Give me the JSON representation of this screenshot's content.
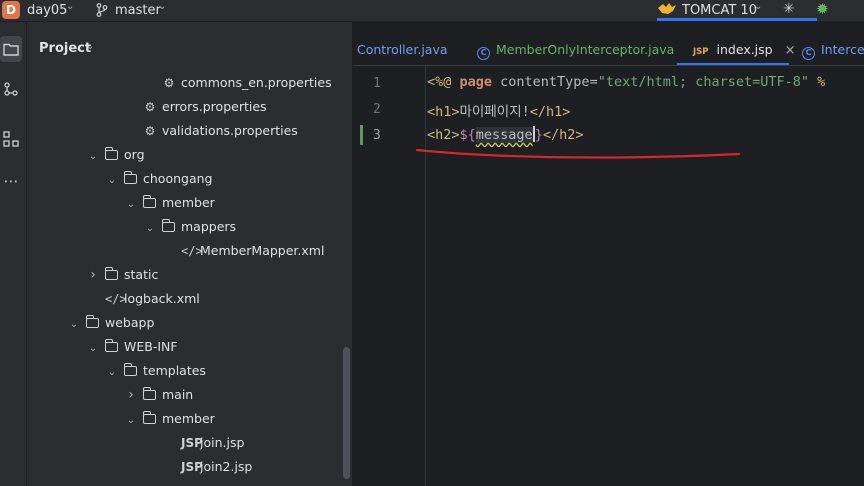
{
  "titlebar": {
    "project_badge": "D",
    "project_name": "day05",
    "branch": "master",
    "run_config": "TOMCAT 10"
  },
  "project_panel": {
    "title": "Project",
    "tree": [
      {
        "label": "commons_en.properties",
        "type": "properties",
        "depth": 7,
        "arrow": ""
      },
      {
        "label": "errors.properties",
        "type": "properties",
        "depth": 6,
        "arrow": ""
      },
      {
        "label": "validations.properties",
        "type": "properties",
        "depth": 6,
        "arrow": ""
      },
      {
        "label": "org",
        "type": "folder",
        "depth": 4,
        "arrow": "down"
      },
      {
        "label": "choongang",
        "type": "folder",
        "depth": 5,
        "arrow": "down"
      },
      {
        "label": "member",
        "type": "folder",
        "depth": 6,
        "arrow": "down"
      },
      {
        "label": "mappers",
        "type": "folder",
        "depth": 7,
        "arrow": "down"
      },
      {
        "label": "MemberMapper.xml",
        "type": "xml",
        "depth": 8,
        "arrow": ""
      },
      {
        "label": "static",
        "type": "folder",
        "depth": 4,
        "arrow": "right"
      },
      {
        "label": "logback.xml",
        "type": "xml",
        "depth": 4,
        "arrow": ""
      },
      {
        "label": "webapp",
        "type": "folder",
        "depth": 3,
        "arrow": "down"
      },
      {
        "label": "WEB-INF",
        "type": "folder",
        "depth": 4,
        "arrow": "down"
      },
      {
        "label": "templates",
        "type": "folder",
        "depth": 5,
        "arrow": "down"
      },
      {
        "label": "main",
        "type": "folder",
        "depth": 6,
        "arrow": "right"
      },
      {
        "label": "member",
        "type": "folder",
        "depth": 6,
        "arrow": "down"
      },
      {
        "label": "join.jsp",
        "type": "jsp",
        "depth": 8,
        "arrow": ""
      },
      {
        "label": "join2.jsp",
        "type": "jsp",
        "depth": 8,
        "arrow": ""
      }
    ]
  },
  "tabs": [
    {
      "label": "Controller.java",
      "icon": "none",
      "active": false
    },
    {
      "label": "MemberOnlyInterceptor.java",
      "icon": "class",
      "active": false
    },
    {
      "label": "index.jsp",
      "icon": "jsp",
      "active": true,
      "close": "×"
    },
    {
      "label": "Intercep",
      "icon": "class",
      "active": false
    }
  ],
  "editor": {
    "line_numbers": [
      "1",
      "2",
      "3"
    ],
    "lines": [
      {
        "open": "<%@ ",
        "kw": "page",
        "attr": " contentType=",
        "str": "\"text/html; charset=UTF-8\"",
        "rest": " %"
      },
      {
        "open": "<h1>",
        "text": "마이페이지!",
        "close": "</h1>"
      },
      {
        "open": "<h2>",
        "el_open": "${",
        "var": "message",
        "el_close": "}",
        "close": "</h2>"
      }
    ]
  },
  "icons": {
    "jsp_label": "JSP",
    "class_label": "C",
    "xml_label": "</>",
    "properties_label": "⚙"
  },
  "colors": {
    "accent": "#3574f0",
    "annotation": "#d9262b"
  }
}
